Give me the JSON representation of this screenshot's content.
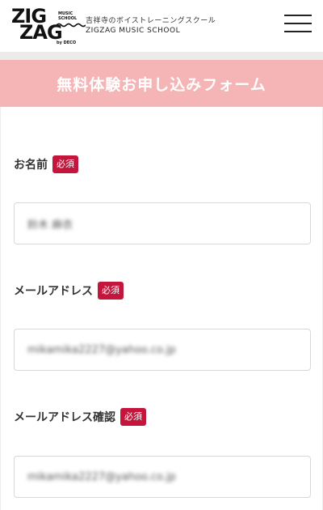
{
  "header": {
    "logo": {
      "line1": "ZIG",
      "line2": "ZAG",
      "sub": "MUSIC SCHOOL",
      "by": "by DECO"
    },
    "tagline": "吉祥寺のボイストレーニングスクール",
    "school_name": "ZIGZAG MUSIC SCHOOL",
    "menu_icon": "hamburger-icon"
  },
  "banner": {
    "title": "無料体験お申し込みフォーム"
  },
  "form": {
    "fields": [
      {
        "label": "お名前",
        "badge": "必須",
        "value": "鈴木 麻衣"
      },
      {
        "label": "メールアドレス",
        "badge": "必須",
        "value": "mikamika2227@yahoo.co.jp"
      },
      {
        "label": "メールアドレス確認",
        "badge": "必須",
        "value": "mikamika2227@yahoo.co.jp"
      }
    ]
  },
  "colors": {
    "banner_bg": "#f5b4b5",
    "required_badge": "#c4163c",
    "divider": "#ecebea"
  }
}
